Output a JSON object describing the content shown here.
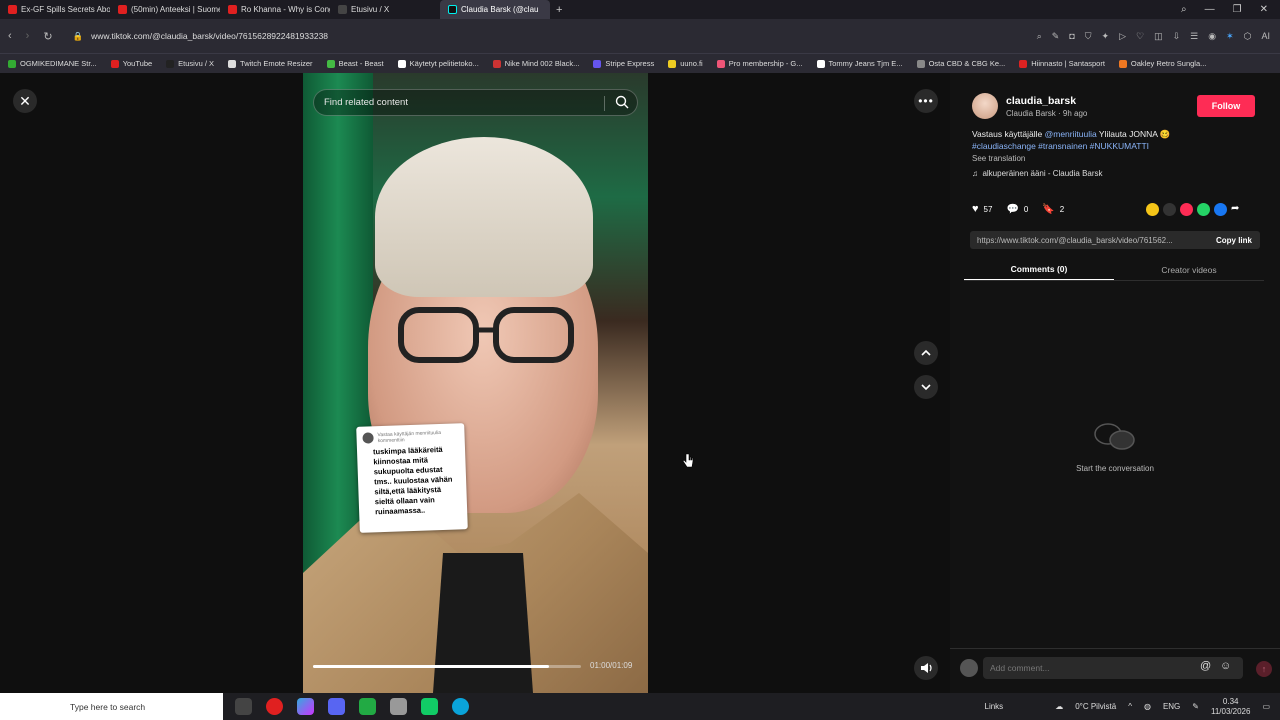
{
  "browser": {
    "tabs": [
      {
        "title": "Ex-GF Spills Secrets About",
        "color": "#e02020"
      },
      {
        "title": "(50min) Anteeksi | Suome",
        "color": "#e02020"
      },
      {
        "title": "Ro Khanna - Why is Cong",
        "color": "#e02020"
      },
      {
        "title": "Etusivu / X",
        "color": "#222222"
      },
      {
        "title": "Claudia Barsk (@clau",
        "color": "#111111"
      }
    ],
    "url": "www.tiktok.com/@claudia_barsk/video/7615628922481933238",
    "ai_label": "AI",
    "bookmarks": [
      {
        "label": "OGMIKEDIMANE Str...",
        "color": "#33aa33"
      },
      {
        "label": "YouTube",
        "color": "#e02020"
      },
      {
        "label": "Etusivu / X",
        "color": "#222222"
      },
      {
        "label": "Twitch Emote Resizer",
        "color": "#dddddd"
      },
      {
        "label": "Beast - Beast",
        "color": "#44bb44"
      },
      {
        "label": "Käytetyt pelitietoko...",
        "color": "#ffffff"
      },
      {
        "label": "Nike Mind 002 Black...",
        "color": "#cc3333"
      },
      {
        "label": "Stripe Express",
        "color": "#6655ee"
      },
      {
        "label": "uuno.fi",
        "color": "#eecc22"
      },
      {
        "label": "Pro membership - G...",
        "color": "#ee5577"
      },
      {
        "label": "Tommy Jeans Tjm E...",
        "color": "#ffffff"
      },
      {
        "label": "Osta CBD & CBG Ke...",
        "color": "#888888"
      },
      {
        "label": "Hiinnasto | Santasport",
        "color": "#dd2222"
      },
      {
        "label": "Oakley Retro Sungla...",
        "color": "#ee7722"
      }
    ]
  },
  "video": {
    "search_placeholder": "Find related content",
    "note_header": "Vastaa käyttäjän menriituulia kommenttiin",
    "note_text": "tuskimpa lääkäreitä kiinnostaa mitä sukupuolta edustat tms.. kuulostaa vähän siltä,että lääkitystä sieltä ollaan vain ruinaamassa..",
    "time": "01:00/01:09",
    "progress": 0.88
  },
  "panel": {
    "username": "claudia_barsk",
    "subline": "Claudia Barsk · 9h ago",
    "follow_label": "Follow",
    "desc_prefix": "Vastaus käyttäjälle ",
    "desc_mention": "@menriituulia",
    "desc_rest": " Ylilauta JONNA 🥴",
    "desc_tags": "#claudiaschange #transnainen #NUKKUMATTI",
    "see_translation": "See translation",
    "music": "alkuperäinen ääni - Claudia Barsk",
    "likes": "57",
    "comments": "0",
    "saves": "2",
    "link": "https://www.tiktok.com/@claudia_barsk/video/761562...",
    "copy_link": "Copy link",
    "tab_comments": "Comments (0)",
    "tab_creator": "Creator videos",
    "empty_text": "Start the conversation",
    "comment_placeholder": "Add comment...",
    "at_symbol": "@"
  },
  "taskbar": {
    "search": "Type here to search",
    "links": "Links",
    "weather": "0°C  Pilvistä",
    "lang": "ENG",
    "time": "0.34",
    "date": "11/03/2026"
  }
}
